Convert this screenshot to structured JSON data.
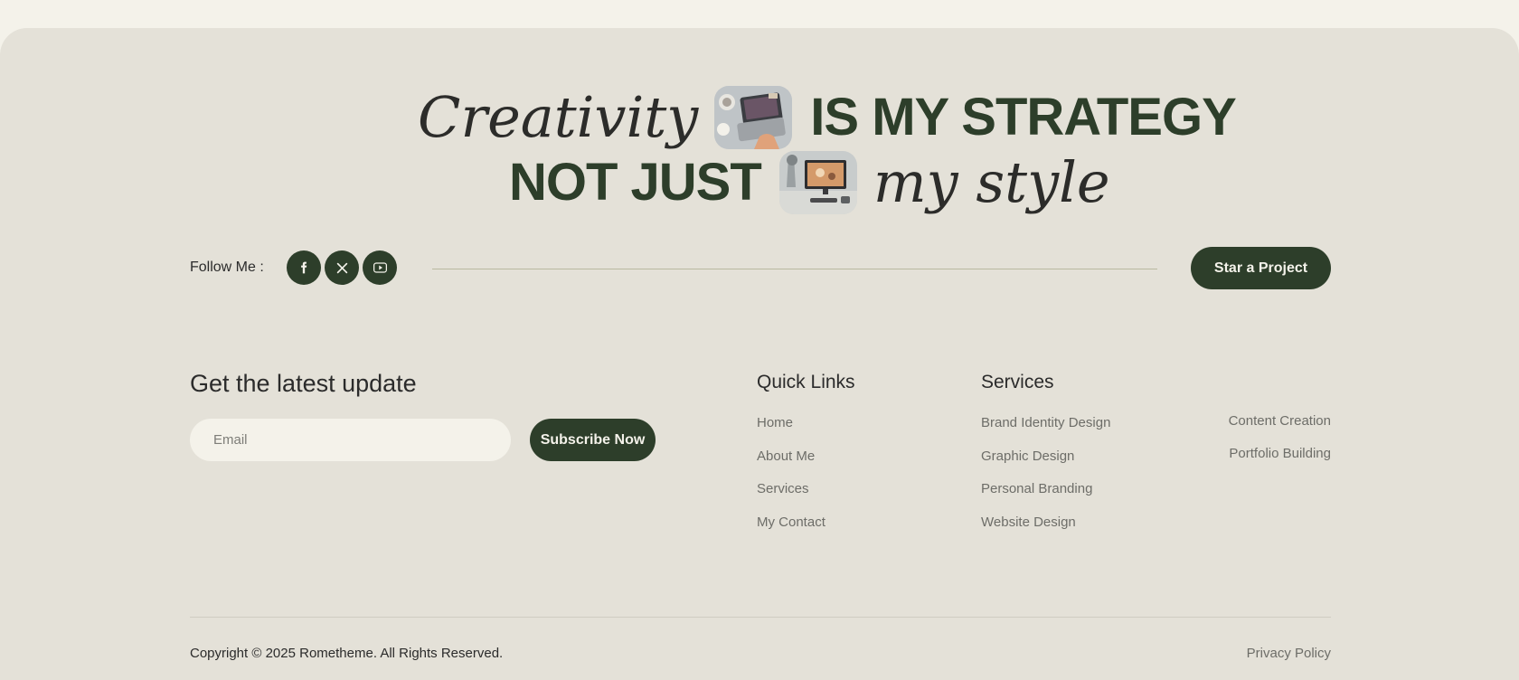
{
  "hero": {
    "line1_script": "Creativity",
    "line1_caps": "IS MY STRATEGY",
    "line2_caps": "NOT JUST",
    "line2_script": "my style"
  },
  "follow": {
    "label": "Follow Me :",
    "socials": [
      "facebook-icon",
      "x-icon",
      "youtube-icon"
    ]
  },
  "cta": {
    "label": "Star a Project"
  },
  "newsletter": {
    "title": "Get the latest update",
    "email_placeholder": "Email",
    "email_value": "",
    "subscribe_label": "Subscribe Now"
  },
  "quick_links": {
    "title": "Quick Links",
    "items": [
      "Home",
      "About Me",
      "Services",
      "My Contact"
    ]
  },
  "services": {
    "title": "Services",
    "items": [
      "Brand Identity Design",
      "Graphic Design",
      "Personal Branding",
      "Website Design"
    ],
    "extra_items": [
      "Content Creation",
      "Portfolio Building"
    ]
  },
  "bottom": {
    "copyright": "Copyright © 2025 Rometheme. All Rights Reserved.",
    "privacy": "Privacy Policy"
  },
  "colors": {
    "page_bg": "#f4f2ea",
    "footer_bg": "#e4e1d8",
    "accent": "#2d3e2a"
  }
}
